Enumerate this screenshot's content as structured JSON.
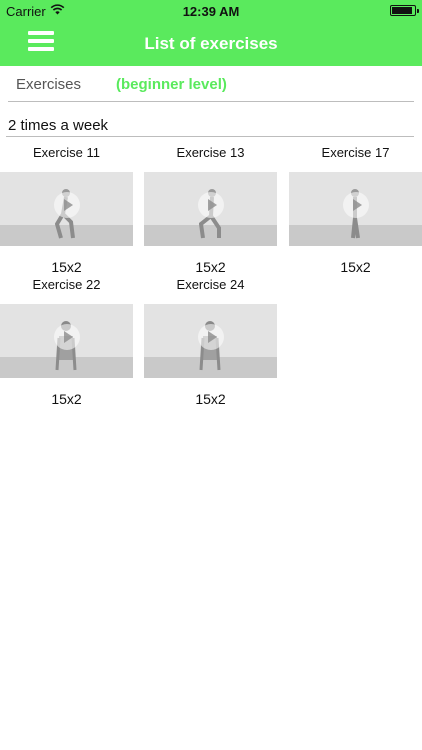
{
  "status_bar": {
    "carrier": "Carrier",
    "time": "12:39 AM"
  },
  "nav": {
    "title": "List of exercises"
  },
  "tabs": {
    "exercises_label": "Exercises",
    "level_label": "(beginner level)"
  },
  "frequency": "2 times a week",
  "exercises": [
    {
      "title": "Exercise 11",
      "count": "15x2"
    },
    {
      "title": "Exercise 13",
      "count": "15x2"
    },
    {
      "title": "Exercise 17",
      "count": "15x2"
    },
    {
      "title": "Exercise 22",
      "count": "15x2"
    },
    {
      "title": "Exercise 24",
      "count": "15x2"
    }
  ],
  "colors": {
    "header_green": "#5aea5d",
    "level_green": "#5aea5d"
  }
}
